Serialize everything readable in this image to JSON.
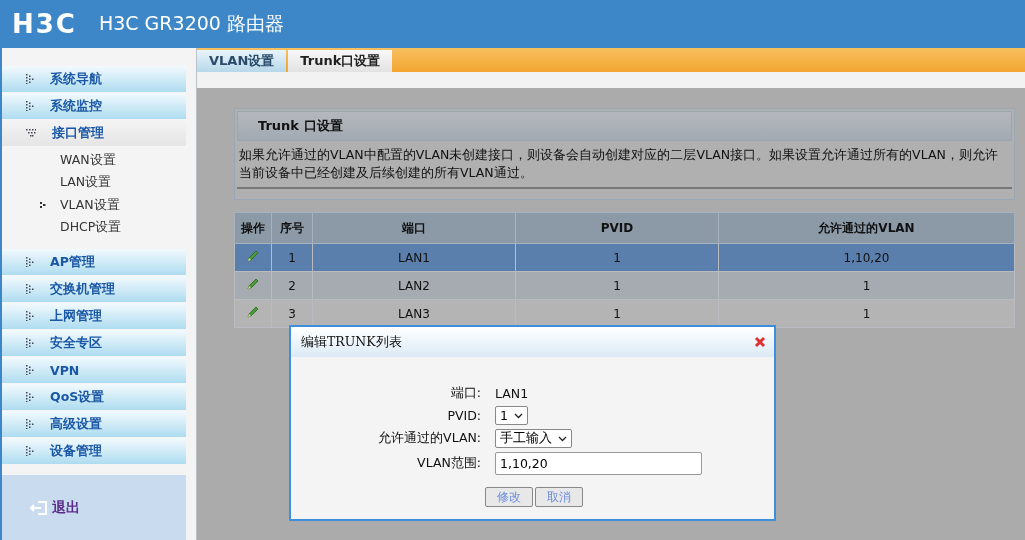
{
  "header": {
    "logo": "H3C",
    "title": "H3C GR3200 路由器"
  },
  "sidebar": {
    "items": [
      {
        "label": "系统导航",
        "expanded": false
      },
      {
        "label": "系统监控",
        "expanded": false
      },
      {
        "label": "接口管理",
        "expanded": true,
        "children": [
          {
            "label": "WAN设置",
            "selected": false
          },
          {
            "label": "LAN设置",
            "selected": false
          },
          {
            "label": "VLAN设置",
            "selected": true
          },
          {
            "label": "DHCP设置",
            "selected": false
          }
        ]
      },
      {
        "label": "AP管理",
        "expanded": false
      },
      {
        "label": "交换机管理",
        "expanded": false
      },
      {
        "label": "上网管理",
        "expanded": false
      },
      {
        "label": "安全专区",
        "expanded": false
      },
      {
        "label": "VPN",
        "expanded": false
      },
      {
        "label": "QoS设置",
        "expanded": false
      },
      {
        "label": "高级设置",
        "expanded": false
      },
      {
        "label": "设备管理",
        "expanded": false
      }
    ],
    "logout": "退出"
  },
  "tabs": [
    {
      "label": "VLAN设置",
      "selected": false
    },
    {
      "label": "Trunk口设置",
      "selected": true
    }
  ],
  "panel": {
    "title": "Trunk 口设置",
    "description": "如果允许通过的VLAN中配置的VLAN未创建接口，则设备会自动创建对应的二层VLAN接口。如果设置允许通过所有的VLAN，则允许当前设备中已经创建及后续创建的所有VLAN通过。"
  },
  "table": {
    "columns": [
      "操作",
      "序号",
      "端口",
      "PVID",
      "允许通过的VLAN"
    ],
    "rows": [
      {
        "index": "1",
        "port": "LAN1",
        "pvid": "1",
        "vlans": "1,10,20",
        "selected": true
      },
      {
        "index": "2",
        "port": "LAN2",
        "pvid": "1",
        "vlans": "1",
        "selected": false
      },
      {
        "index": "3",
        "port": "LAN3",
        "pvid": "1",
        "vlans": "1",
        "selected": false
      }
    ]
  },
  "dialog": {
    "title": "编辑TRUNK列表",
    "port_label": "端口:",
    "port_value": "LAN1",
    "pvid_label": "PVID:",
    "pvid_value": "1",
    "vlan_mode_label": "允许通过的VLAN:",
    "vlan_mode_value": "手工输入",
    "range_label": "VLAN范围:",
    "range_value": "1,10,20",
    "buttons": [
      "修改",
      "取消"
    ]
  }
}
